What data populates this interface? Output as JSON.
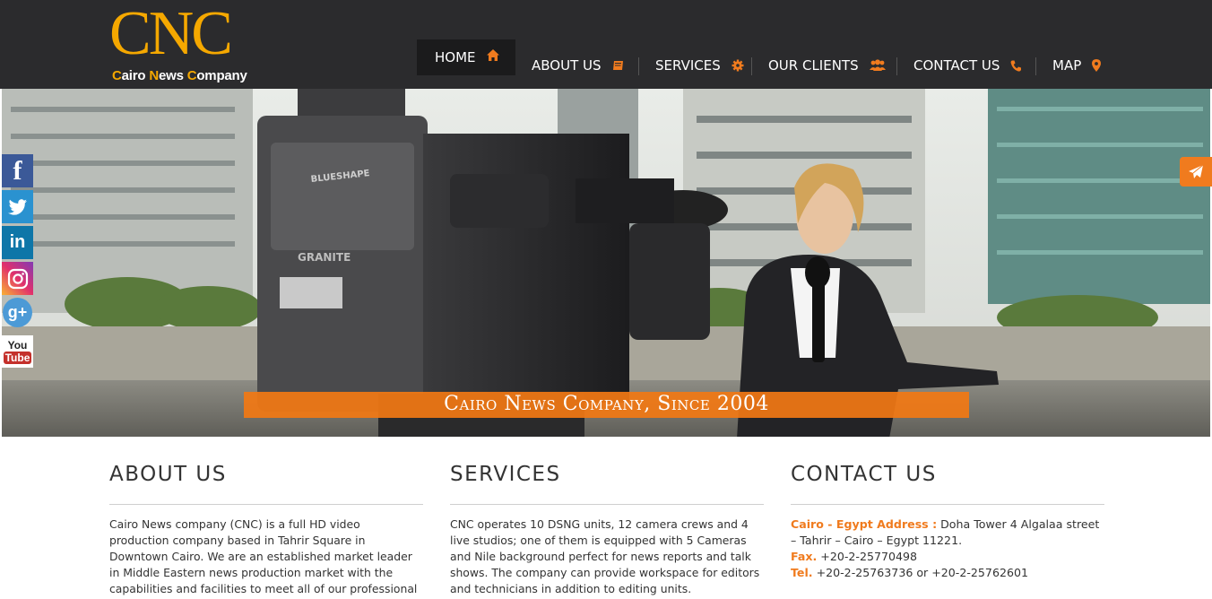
{
  "logo": {
    "main": "CNC",
    "w1_cap": "C",
    "w1_rest": "airo ",
    "w2_cap": "N",
    "w2_rest": "ews ",
    "w3_cap": "C",
    "w3_rest": "ompany"
  },
  "nav": [
    {
      "label": "HOME",
      "icon": "home-icon"
    },
    {
      "label": "ABOUT US",
      "icon": "book-icon"
    },
    {
      "label": "SERVICES",
      "icon": "gear-icon"
    },
    {
      "label": "OUR CLIENTS",
      "icon": "users-icon"
    },
    {
      "label": "CONTACT US",
      "icon": "phone-icon"
    },
    {
      "label": "MAP",
      "icon": "map-marker-icon"
    }
  ],
  "hero": {
    "banner": "Cairo News Company, Since 2004",
    "camera_brand": "BLUESHAPE",
    "camera_model": "GRANITE"
  },
  "social": {
    "linkedin": "in",
    "googleplus": "g+",
    "youtube_you": "You",
    "youtube_tube": "Tube",
    "facebook": "f"
  },
  "about": {
    "title": "ABOUT US",
    "text": "Cairo News company (CNC) is a full HD video production company based in Tahrir Square in Downtown Cairo. We are an established market leader in Middle Eastern news production market with the capabilities and facilities to meet all of our professional TV production needs."
  },
  "services": {
    "title": "SERVICES",
    "text": "CNC operates 10 DSNG units, 12 camera crews and 4 live studios; one of them is equipped with 5 Cameras and Nile background perfect for news reports and talk shows. The company can provide workspace for editors and technicians in addition to editing units."
  },
  "contact": {
    "title": "CONTACT US",
    "address_label": "Cairo - Egypt Address :",
    "address": " Doha Tower  4 Algalaa street – Tahrir – Cairo – Egypt 11221.",
    "fax_label": "Fax.",
    "fax": " +20-2-25770498",
    "tel_label": "Tel.",
    "tel": " +20-2-25763736 or +20-2-25762601"
  },
  "colors": {
    "accent": "#f07b1e",
    "logo": "#f5a800",
    "header_bg": "#2b2b2d"
  }
}
